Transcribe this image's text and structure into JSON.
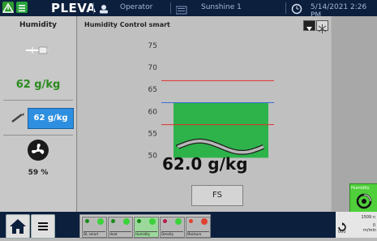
{
  "topbar": {
    "brand": "PLEVA",
    "user": "Operator",
    "recipe": "Sunshine 1",
    "datetime": "5/14/2021 2:26 PM"
  },
  "left_panel": {
    "title": "Humidity",
    "measured_value": "62 g/kg",
    "setpoint_value": "62 g/kg",
    "fan_percent": "59 %"
  },
  "main": {
    "title": "Humidity Control smart",
    "current_value": "62.0 g/kg",
    "fs_button": "FS"
  },
  "chart_data": {
    "type": "area",
    "yticks": [
      75,
      70,
      65,
      60,
      55,
      50
    ],
    "ylim": [
      47,
      77
    ],
    "fill_level": 62.0,
    "setpoint_line": 62,
    "upper_limit": 67,
    "lower_limit": 57,
    "colors": {
      "fill": "#2db34a",
      "upper": "#e03030",
      "lower": "#e03030",
      "setpoint": "#3a6bd8",
      "wave": "#9a9a9a"
    }
  },
  "right": {
    "humidity_tile_label": "Humidity"
  },
  "bottom": {
    "modules": [
      {
        "label": "DL smart"
      },
      {
        "label": "Heat"
      },
      {
        "label": "Humidity"
      },
      {
        "label": "Density"
      },
      {
        "label": "Moisture"
      }
    ],
    "readout_value": "1509 n",
    "readout_value2": "0",
    "readout_unit": "m/min",
    "readout_small": "000"
  },
  "colors": {
    "topbar_bg": "#0c1f3d",
    "accent_green": "#2a8a1e",
    "setpoint_blue": "#2e8fe0"
  }
}
